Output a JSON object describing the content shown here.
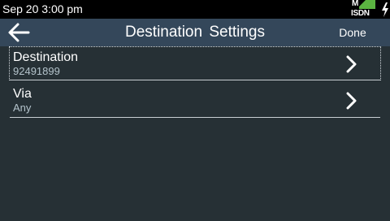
{
  "status_bar": {
    "datetime": "Sep 20 3:00 pm",
    "network_badge_top": "M",
    "network_badge_label": "ISDN",
    "network_badge_color": "#5bb441",
    "power_icon": "lightning-bolt"
  },
  "header": {
    "back_icon": "arrow-left",
    "title": "Destination Settings",
    "done_label": "Done"
  },
  "items": [
    {
      "title": "Destination",
      "value": "92491899",
      "icon": "chevron-right"
    },
    {
      "title": "Via",
      "value": "Any",
      "icon": "chevron-right"
    }
  ],
  "colors": {
    "background": "#263035",
    "header": "#34475a",
    "status_bar": "#000000",
    "secondary_text": "#b4c3cb"
  }
}
